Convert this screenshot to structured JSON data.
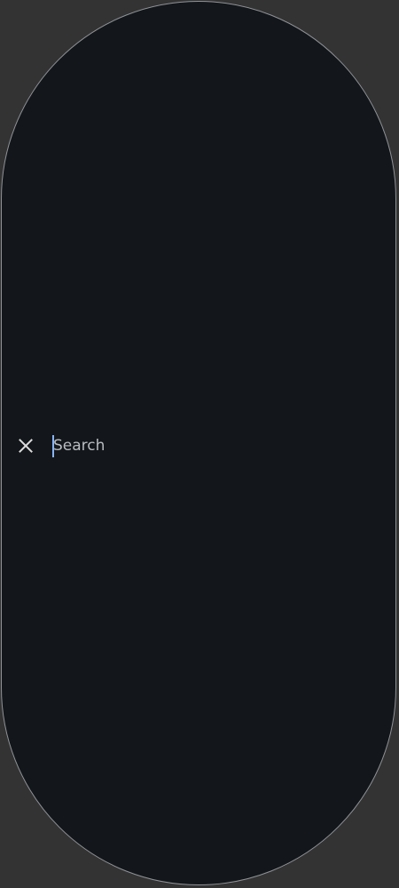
{
  "search": {
    "placeholder": "Search",
    "value": ""
  },
  "icons": {
    "close": "close-icon"
  },
  "colors": {
    "background": "#333333",
    "panel": "#13161a",
    "border": "#8f9296",
    "caret": "#8ab4f8",
    "placeholder": "#b9bcc0",
    "icon": "#dcdcdc"
  }
}
